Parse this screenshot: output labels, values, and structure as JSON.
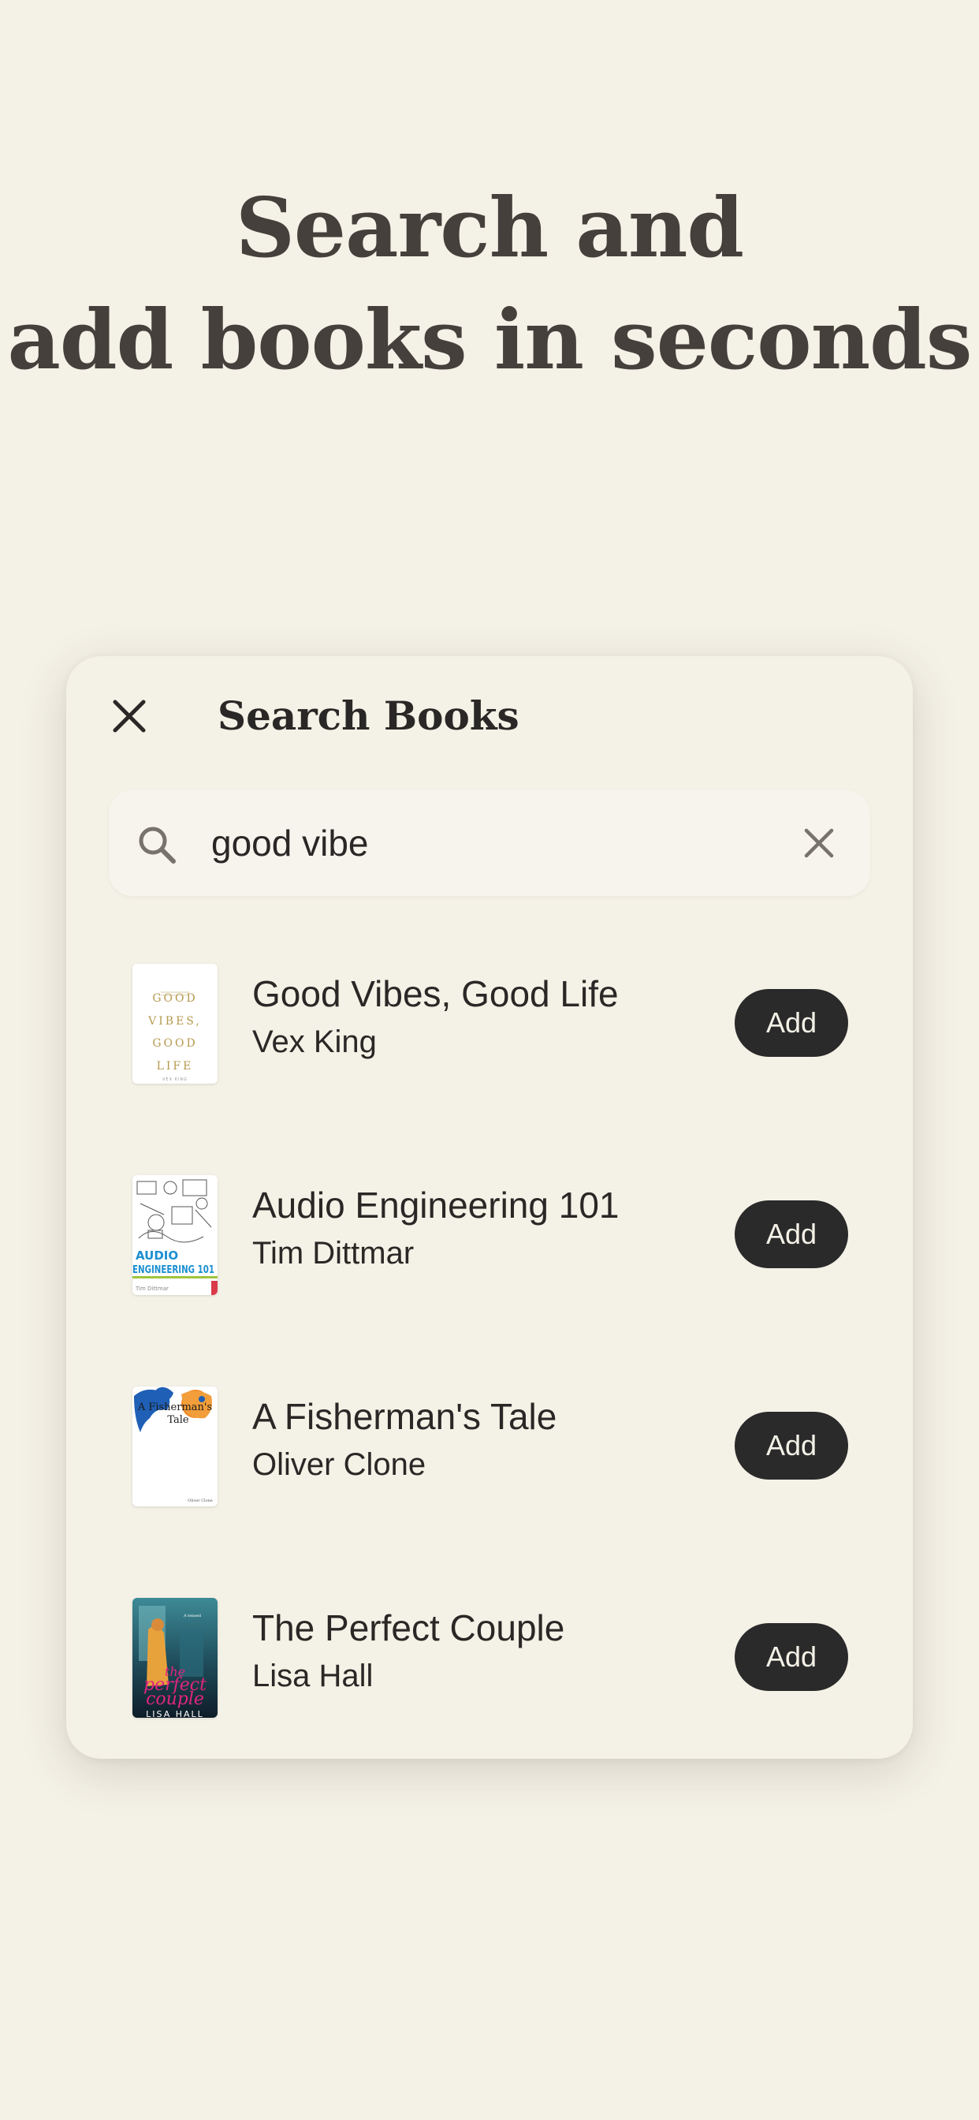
{
  "headline": {
    "line1": "Search and",
    "line2": "add books in seconds"
  },
  "modal": {
    "title": "Search Books",
    "close_icon": "close-icon",
    "search": {
      "value": "good vibe",
      "icon": "search-icon",
      "clear_icon": "clear-icon"
    },
    "results": [
      {
        "title": "Good Vibes, Good Life",
        "author": "Vex King",
        "button": "Add",
        "cover_text": [
          "GOOD",
          "VIBES,",
          "GOOD",
          "LIFE",
          "VEX KING"
        ]
      },
      {
        "title": "Audio Engineering 101",
        "author": "Tim Dittmar",
        "button": "Add",
        "cover_text": [
          "AUDIO",
          "ENGINEERING 101",
          "Tim Dittmar"
        ]
      },
      {
        "title": "A Fisherman's Tale",
        "author": "Oliver Clone",
        "button": "Add",
        "cover_text": [
          "A Fisherman's",
          "Tale",
          "Oliver Clone"
        ]
      },
      {
        "title": "The Perfect Couple",
        "author": "Lisa Hall",
        "button": "Add",
        "cover_text": [
          "the",
          "perfect",
          "couple",
          "LISA HALL"
        ]
      }
    ]
  },
  "colors": {
    "background": "#f4f1e7",
    "card": "#f4f1e6",
    "button": "#2a2a2a",
    "headline": "#45403b"
  }
}
